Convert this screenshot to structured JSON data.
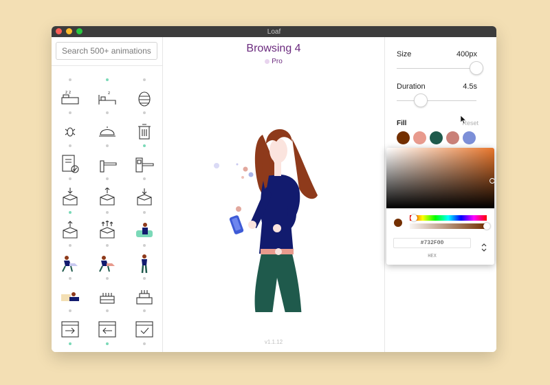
{
  "window": {
    "title": "Loaf"
  },
  "sidebar": {
    "search_placeholder": "Search 500+ animations",
    "icons": [
      {
        "icon": "box-partial-icon",
        "dot": "#CFCFCF"
      },
      {
        "icon": "box-partial-icon",
        "dot": "#7BD9B8"
      },
      {
        "icon": "person-partial-icon",
        "dot": "#CFCFCF"
      },
      {
        "icon": "sleeping-bed-icon",
        "dot": "#CFCFCF"
      },
      {
        "icon": "sleeping-bed-alt-icon",
        "dot": "#CFCFCF"
      },
      {
        "icon": "beehive-icon",
        "dot": "#CFCFCF"
      },
      {
        "icon": "bug-icon",
        "dot": "#CFCFCF"
      },
      {
        "icon": "service-bell-icon",
        "dot": "#CFCFCF"
      },
      {
        "icon": "trash-can-icon",
        "dot": "#7BD9B8"
      },
      {
        "icon": "approved-document-icon",
        "dot": "#CFCFCF"
      },
      {
        "icon": "barrier-gate-icon",
        "dot": "#CFCFCF"
      },
      {
        "icon": "toll-gate-icon",
        "dot": "#CFCFCF"
      },
      {
        "icon": "box-arrow-down-icon",
        "dot": "#7BD9B8"
      },
      {
        "icon": "box-arrow-up-icon",
        "dot": "#CFCFCF"
      },
      {
        "icon": "box-arrow-in-icon",
        "dot": "#CFCFCF"
      },
      {
        "icon": "box-upload-icon",
        "dot": "#CFCFCF"
      },
      {
        "icon": "box-multi-upload-icon",
        "dot": "#CFCFCF"
      },
      {
        "icon": "person-couch-icon",
        "dot": "#CFCFCF"
      },
      {
        "icon": "person-laptop-icon",
        "dot": "#CFCFCF"
      },
      {
        "icon": "person-laptop-alt-icon",
        "dot": "#CFCFCF"
      },
      {
        "icon": "person-standing-icon",
        "dot": "#CFCFCF"
      },
      {
        "icon": "person-lying-icon",
        "dot": "#CFCFCF"
      },
      {
        "icon": "birthday-cake-icon",
        "dot": "#CFCFCF"
      },
      {
        "icon": "birthday-cake-tall-icon",
        "dot": "#CFCFCF"
      },
      {
        "icon": "calendar-arrow-right-icon",
        "dot": "#7BD9B8"
      },
      {
        "icon": "calendar-arrow-left-icon",
        "dot": "#7BD9B8"
      },
      {
        "icon": "calendar-check-icon",
        "dot": "#CFCFCF"
      }
    ]
  },
  "preview": {
    "title": "Browsing 4",
    "badge": "Pro",
    "version": "v1.1.12"
  },
  "settings": {
    "size_label": "Size",
    "size_value": "400px",
    "size_fraction": 1.0,
    "duration_label": "Duration",
    "duration_value": "4.5s",
    "duration_fraction": 0.3,
    "fill_label": "Fill",
    "reset_label": "Reset",
    "swatches": [
      "#732F00",
      "#E89A8D",
      "#1F5A4C",
      "#C98078",
      "#7C8FD8"
    ]
  },
  "color_picker": {
    "hex_value": "#732F00",
    "mode_label": "HEX",
    "base_hue_color": "#E8762C",
    "hue_fraction": 0.05,
    "alpha_fraction": 1.0
  }
}
